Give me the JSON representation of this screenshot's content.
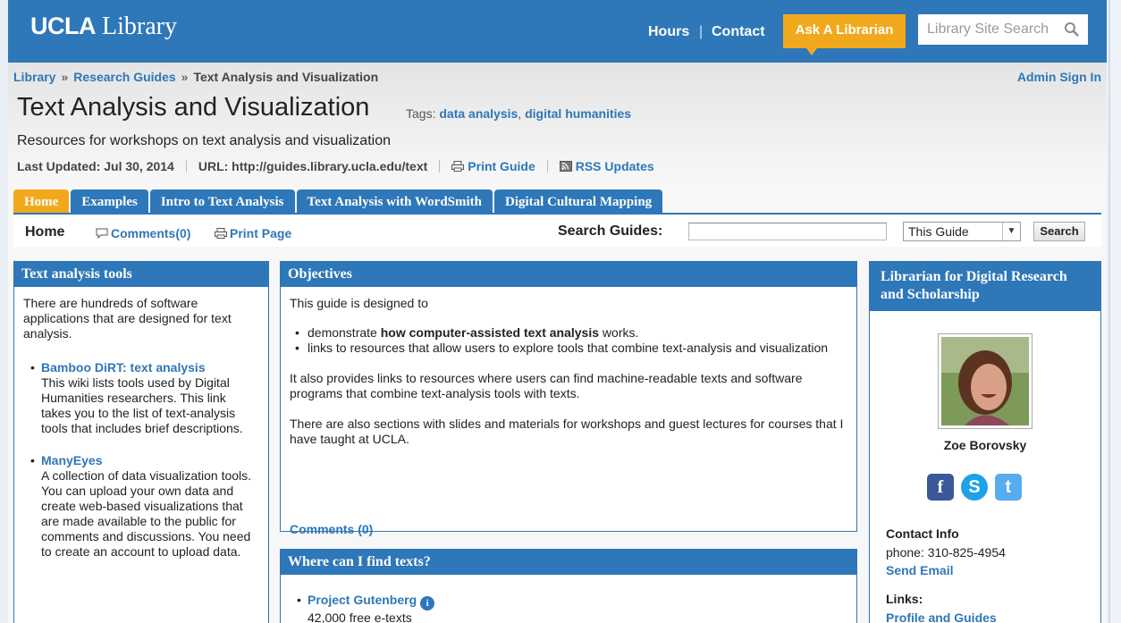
{
  "header": {
    "logo_bold": "UCLA",
    "logo_rest": "Library",
    "hours": "Hours",
    "contact": "Contact",
    "ask": "Ask A Librarian",
    "search_placeholder": "Library Site Search",
    "brand_color": "#2e77b8",
    "accent_color": "#f2a81d"
  },
  "breadcrumb": {
    "items": [
      "Library",
      "Research Guides"
    ],
    "current": "Text Analysis and Visualization",
    "separator": "»"
  },
  "admin_sign_in": "Admin Sign In",
  "guide": {
    "title": "Text Analysis and Visualization",
    "tags_label": "Tags:",
    "tags": [
      "data analysis",
      "digital humanities"
    ],
    "description": "Resources for workshops on text analysis and visualization",
    "last_updated": "Last Updated: Jul 30, 2014",
    "url": "URL: http://guides.library.ucla.edu/text",
    "print_guide": "Print Guide",
    "rss_updates": "RSS Updates"
  },
  "tabs": [
    {
      "label": "Home",
      "active": true
    },
    {
      "label": "Examples",
      "active": false
    },
    {
      "label": "Intro to Text Analysis",
      "active": false
    },
    {
      "label": "Text Analysis with WordSmith",
      "active": false
    },
    {
      "label": "Digital Cultural Mapping",
      "active": false
    }
  ],
  "page_bar": {
    "page_name": "Home",
    "comments": "Comments(0)",
    "print_page": "Print Page",
    "search_label": "Search Guides:",
    "scope_option": "This Guide",
    "search_button": "Search"
  },
  "box_tools": {
    "title": "Text analysis tools",
    "intro": "There are hundreds of software applications that are designed for text analysis.",
    "items": [
      {
        "name": "Bamboo DiRT: text analysis",
        "desc": "This wiki lists tools used by Digital Humanities researchers. This link takes you to the list of text-analysis tools that includes brief descriptions."
      },
      {
        "name": "ManyEyes",
        "desc": "A collection of data visualization tools. You can upload your own data and create web-based visualizations that are made available to the public for comments and discussions. You need to create an account to upload data."
      }
    ]
  },
  "box_objectives": {
    "title": "Objectives",
    "intro": "This guide is designed to",
    "bullet1_pre": "demonstrate ",
    "bullet1_bold": "how computer-assisted text analysis",
    "bullet1_post": " works.",
    "bullet2": "links to resources that allow users to explore tools that combine text-analysis and visualization",
    "para2": "It also provides links to resources where users can find machine-readable texts and software programs that combine text-analysis tools with texts.",
    "para3": "There are also sections with slides and materials for workshops and guest lectures for courses that I have taught at UCLA.",
    "comments": "Comments (0)"
  },
  "box_texts": {
    "title": "Where can I find texts?",
    "item_name": "Project Gutenberg",
    "item_desc": "42,000 free e-texts"
  },
  "box_librarian": {
    "title": "Librarian for Digital Research and Scholarship",
    "name": "Zoe Borovsky",
    "contact_label": "Contact Info",
    "phone": "phone: 310-825-4954",
    "send_email": "Send Email",
    "links_label": "Links:",
    "profile_link": "Profile and Guides",
    "social": [
      "facebook-icon",
      "skype-icon",
      "twitter-icon"
    ]
  }
}
